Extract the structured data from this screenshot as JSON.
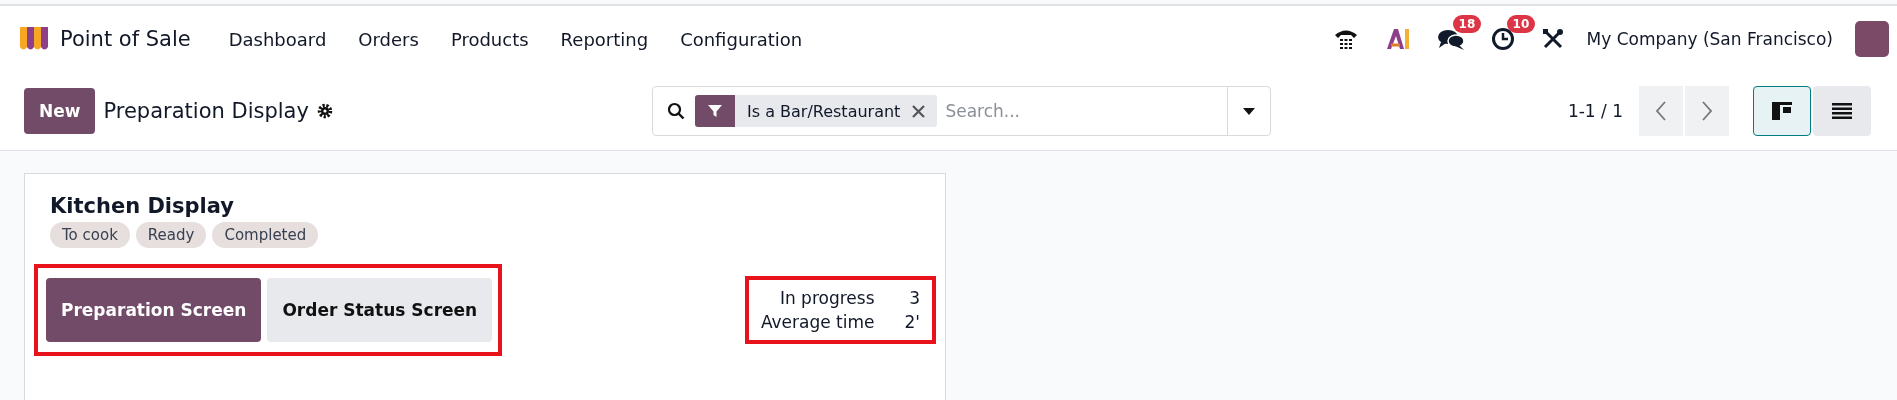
{
  "navbar": {
    "app_name": "Point of Sale",
    "menu": [
      "Dashboard",
      "Orders",
      "Products",
      "Reporting",
      "Configuration"
    ],
    "systray": [
      {
        "kind": "phone"
      },
      {
        "kind": "ai"
      },
      {
        "kind": "chat",
        "badge": "18"
      },
      {
        "kind": "clock",
        "badge": "10"
      },
      {
        "kind": "tools"
      }
    ],
    "company": "My Company (San Francisco)"
  },
  "control_panel": {
    "new_button": "New",
    "title": "Preparation Display",
    "search": {
      "facet": "Is a Bar/Restaurant",
      "placeholder": "Search..."
    },
    "pager": "1-1 / 1",
    "views": [
      {
        "kind": "kanban",
        "selected": true
      },
      {
        "kind": "list",
        "selected": false
      }
    ]
  },
  "cards": [
    {
      "title": "Kitchen Display",
      "tags": [
        "To cook",
        "Ready",
        "Completed"
      ],
      "buttons": [
        {
          "label": "Preparation Screen",
          "primary": true
        },
        {
          "label": "Order Status Screen",
          "primary": false
        }
      ],
      "stats": [
        {
          "label": "In progress",
          "value": "3"
        },
        {
          "label": "Average time",
          "value": "2'"
        }
      ]
    }
  ]
}
